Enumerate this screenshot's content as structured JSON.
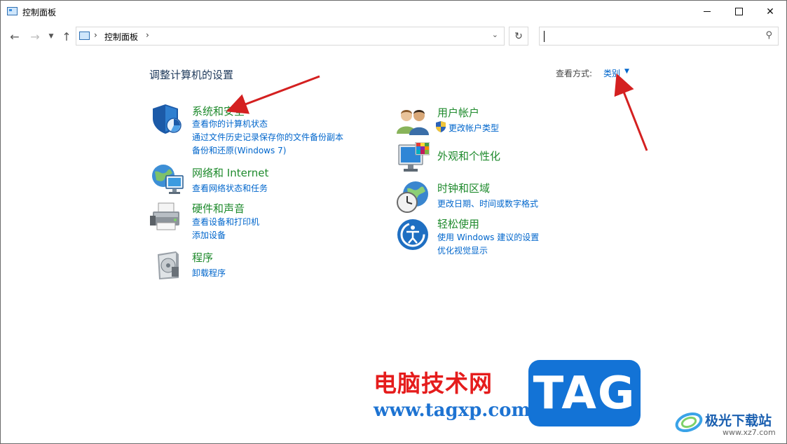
{
  "window": {
    "title": "控制面板",
    "minimize_glyph": "minimize-icon",
    "maximize_glyph": "maximize-icon",
    "close_label": "✕"
  },
  "nav": {
    "address_path": "控制面板",
    "separator": "›",
    "search_placeholder": ""
  },
  "main": {
    "heading": "调整计算机的设置",
    "view_by_label": "查看方式:",
    "view_by_value": "类别"
  },
  "categories": [
    {
      "title": "系统和安全",
      "links": [
        "查看你的计算机状态",
        "通过文件历史记录保存你的文件备份副本",
        "备份和还原(Windows 7)"
      ]
    },
    {
      "title": "网络和 Internet",
      "links": [
        "查看网络状态和任务"
      ]
    },
    {
      "title": "硬件和声音",
      "links": [
        "查看设备和打印机",
        "添加设备"
      ]
    },
    {
      "title": "程序",
      "links": [
        "卸载程序"
      ]
    },
    {
      "title": "用户帐户",
      "links": [
        "更改帐户类型"
      ]
    },
    {
      "title": "外观和个性化",
      "links": []
    },
    {
      "title": "时钟和区域",
      "links": [
        "更改日期、时间或数字格式"
      ]
    },
    {
      "title": "轻松使用",
      "links": [
        "使用 Windows 建议的设置",
        "优化视觉显示"
      ]
    }
  ],
  "watermark": {
    "site_cn": "电脑技术网",
    "site_url": "www.tagxp.com",
    "tag": "TAG",
    "xz_cn": "极光下载站",
    "xz_url": "www.xz7.com"
  },
  "colors": {
    "category_title": "#1e8a2c",
    "link": "#0066cc",
    "heading": "#1e395b",
    "annotation_arrow": "#d42020"
  }
}
